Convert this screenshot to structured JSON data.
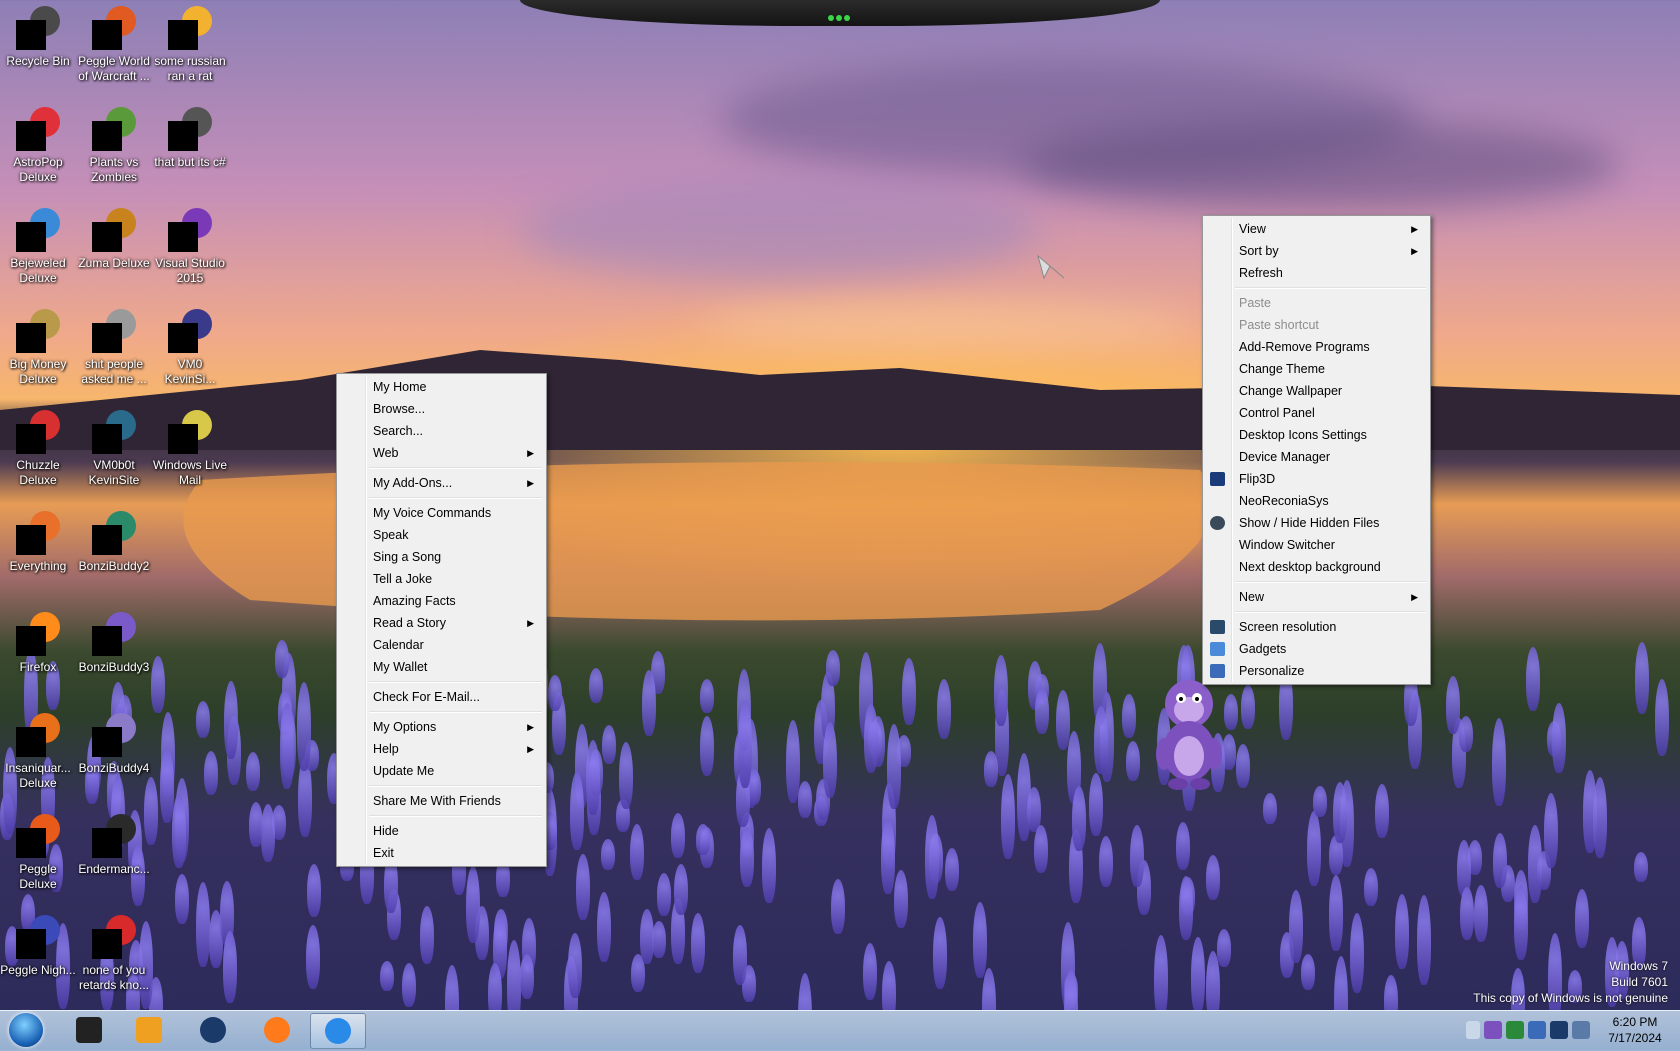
{
  "desktop_icons": [
    {
      "label": "Recycle Bin",
      "color": "#4a4a4a"
    },
    {
      "label": "Peggle World of Warcraft ...",
      "color": "#e05a22"
    },
    {
      "label": "some russian ran a rat",
      "color": "#f2b230"
    },
    {
      "label": "AstroPop Deluxe",
      "color": "#e0303a"
    },
    {
      "label": "Plants vs Zombies",
      "color": "#5a9a3a"
    },
    {
      "label": "that but its c#",
      "color": "#555555"
    },
    {
      "label": "Bejeweled Deluxe",
      "color": "#3a8ad8"
    },
    {
      "label": "Zuma Deluxe",
      "color": "#c8821e"
    },
    {
      "label": "Visual Studio 2015",
      "color": "#7a3ab8"
    },
    {
      "label": "Big Money Deluxe",
      "color": "#b89a4a"
    },
    {
      "label": "shit people asked me ...",
      "color": "#9a9a9a"
    },
    {
      "label": "VM0 KevinSi...",
      "color": "#3a3a8a"
    },
    {
      "label": "Chuzzle Deluxe",
      "color": "#d83030"
    },
    {
      "label": "VM0b0t KevinSite",
      "color": "#2a6a8a"
    },
    {
      "label": "Windows Live Mail",
      "color": "#d8c84a"
    },
    {
      "label": "Everything",
      "color": "#e8702a"
    },
    {
      "label": "BonziBuddy2",
      "color": "#2a8a6a"
    },
    {
      "label": "Firefox",
      "color": "#ff8c1a"
    },
    {
      "label": "BonziBuddy3",
      "color": "#7a5ac8"
    },
    {
      "label": "Insaniquar... Deluxe",
      "color": "#e8701a"
    },
    {
      "label": "BonziBuddy4",
      "color": "#8a7ac8"
    },
    {
      "label": "Peggle Deluxe",
      "color": "#e85a1a"
    },
    {
      "label": "Endermanc...",
      "color": "#2a2a2a"
    },
    {
      "label": "Peggle Nigh...",
      "color": "#3a4ab8"
    },
    {
      "label": "none of you retards kno...",
      "color": "#d82a2a"
    }
  ],
  "bonzi_menu": {
    "groups": [
      [
        {
          "label": "My Home"
        },
        {
          "label": "Browse..."
        },
        {
          "label": "Search..."
        },
        {
          "label": "Web",
          "submenu": true
        }
      ],
      [
        {
          "label": "My Add-Ons...",
          "submenu": true
        }
      ],
      [
        {
          "label": "My Voice Commands"
        },
        {
          "label": "Speak"
        },
        {
          "label": "Sing a Song"
        },
        {
          "label": "Tell a Joke"
        },
        {
          "label": "Amazing Facts"
        },
        {
          "label": "Read a Story",
          "submenu": true
        },
        {
          "label": "Calendar"
        },
        {
          "label": "My Wallet"
        }
      ],
      [
        {
          "label": "Check For E-Mail..."
        }
      ],
      [
        {
          "label": "My Options",
          "submenu": true
        },
        {
          "label": "Help",
          "submenu": true
        },
        {
          "label": "Update Me"
        }
      ],
      [
        {
          "label": "Share Me With Friends"
        }
      ],
      [
        {
          "label": "Hide"
        },
        {
          "label": "Exit"
        }
      ]
    ]
  },
  "desktop_menu": {
    "groups": [
      [
        {
          "label": "View",
          "submenu": true
        },
        {
          "label": "Sort by",
          "submenu": true
        },
        {
          "label": "Refresh"
        }
      ],
      [
        {
          "label": "Paste",
          "disabled": true
        },
        {
          "label": "Paste shortcut",
          "disabled": true
        },
        {
          "label": "Add-Remove Programs"
        },
        {
          "label": "Change Theme"
        },
        {
          "label": "Change Wallpaper"
        },
        {
          "label": "Control Panel"
        },
        {
          "label": "Desktop Icons Settings"
        },
        {
          "label": "Device Manager"
        },
        {
          "label": "Flip3D",
          "icon": "flip3d-icon"
        },
        {
          "label": "NeoReconiaSys"
        },
        {
          "label": "Show / Hide Hidden Files",
          "icon": "globe-icon"
        },
        {
          "label": "Window Switcher"
        },
        {
          "label": "Next desktop background"
        }
      ],
      [
        {
          "label": "New",
          "submenu": true
        }
      ],
      [
        {
          "label": "Screen resolution",
          "icon": "monitor-icon"
        },
        {
          "label": "Gadgets",
          "icon": "gadgets-icon"
        },
        {
          "label": "Personalize",
          "icon": "personalize-icon"
        }
      ]
    ]
  },
  "taskbar": {
    "items": [
      {
        "name": "terminal",
        "color": "#222222"
      },
      {
        "name": "media-player",
        "color": "#f0a020"
      },
      {
        "name": "sphere-app",
        "color": "#1a3a6a"
      },
      {
        "name": "firefox",
        "color": "#ff7a1a"
      },
      {
        "name": "internet-explorer",
        "color": "#2a8ae8",
        "active": true
      }
    ],
    "time": "6:20 PM",
    "date": "7/17/2024"
  },
  "watermark": {
    "line1": "Windows 7",
    "line2": "Build 7601",
    "line3": "This copy of Windows is not genuine"
  }
}
